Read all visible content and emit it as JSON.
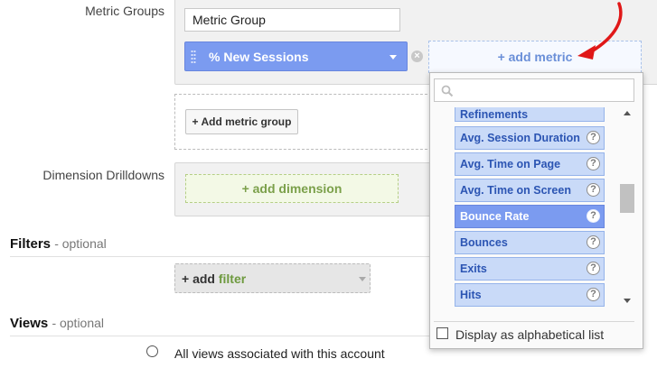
{
  "metric_groups": {
    "label": "Metric Groups",
    "group_name_value": "Metric Group",
    "selected_metric": "% New Sessions",
    "add_metric_label": "+ add metric",
    "add_group_label": "+ Add metric group"
  },
  "dimension_drilldowns": {
    "label": "Dimension Drilldowns",
    "add_dimension_label": "+ add dimension"
  },
  "filters": {
    "title": "Filters",
    "optional": "- optional",
    "add_prefix": "+ add",
    "add_word": "filter"
  },
  "views": {
    "title": "Views",
    "optional": "- optional",
    "option_all": "All views associated with this account"
  },
  "metric_dropdown": {
    "search_value": "",
    "items": [
      {
        "label": "Refinements"
      },
      {
        "label": "Avg. Session Duration"
      },
      {
        "label": "Avg. Time on Page"
      },
      {
        "label": "Avg. Time on Screen"
      },
      {
        "label": "Bounce Rate",
        "selected": true
      },
      {
        "label": "Bounces"
      },
      {
        "label": "Exits"
      },
      {
        "label": "Hits"
      }
    ],
    "help_glyph": "?",
    "alphabetical_label": "Display as alphabetical list"
  },
  "colors": {
    "annotation_arrow": "#e01818",
    "metric_chip": "#7b9bf0",
    "metric_item": "#c9daf8",
    "dimension_green": "#7ba04a"
  }
}
